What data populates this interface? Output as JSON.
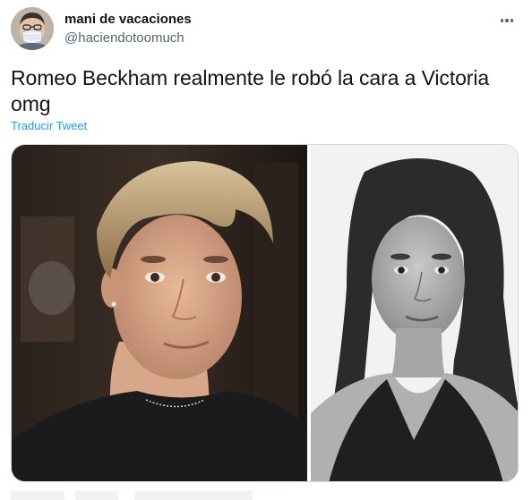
{
  "tweet": {
    "author": {
      "display_name": "mani de vacaciones",
      "handle": "@haciendotoomuch",
      "avatar_icon": "user-avatar-with-mask"
    },
    "more_icon": "more-horizontal-icon",
    "text": "Romeo Beckham realmente le robó la cara a Victoria omg",
    "translate_label": "Traducir Tweet",
    "media": [
      {
        "description_icon": "photo-young-man"
      },
      {
        "description_icon": "photo-young-woman-bw"
      }
    ]
  },
  "colors": {
    "text_primary": "#0f1419",
    "text_secondary": "#536471",
    "link": "#1d9bf0",
    "border": "#cfd9de"
  }
}
